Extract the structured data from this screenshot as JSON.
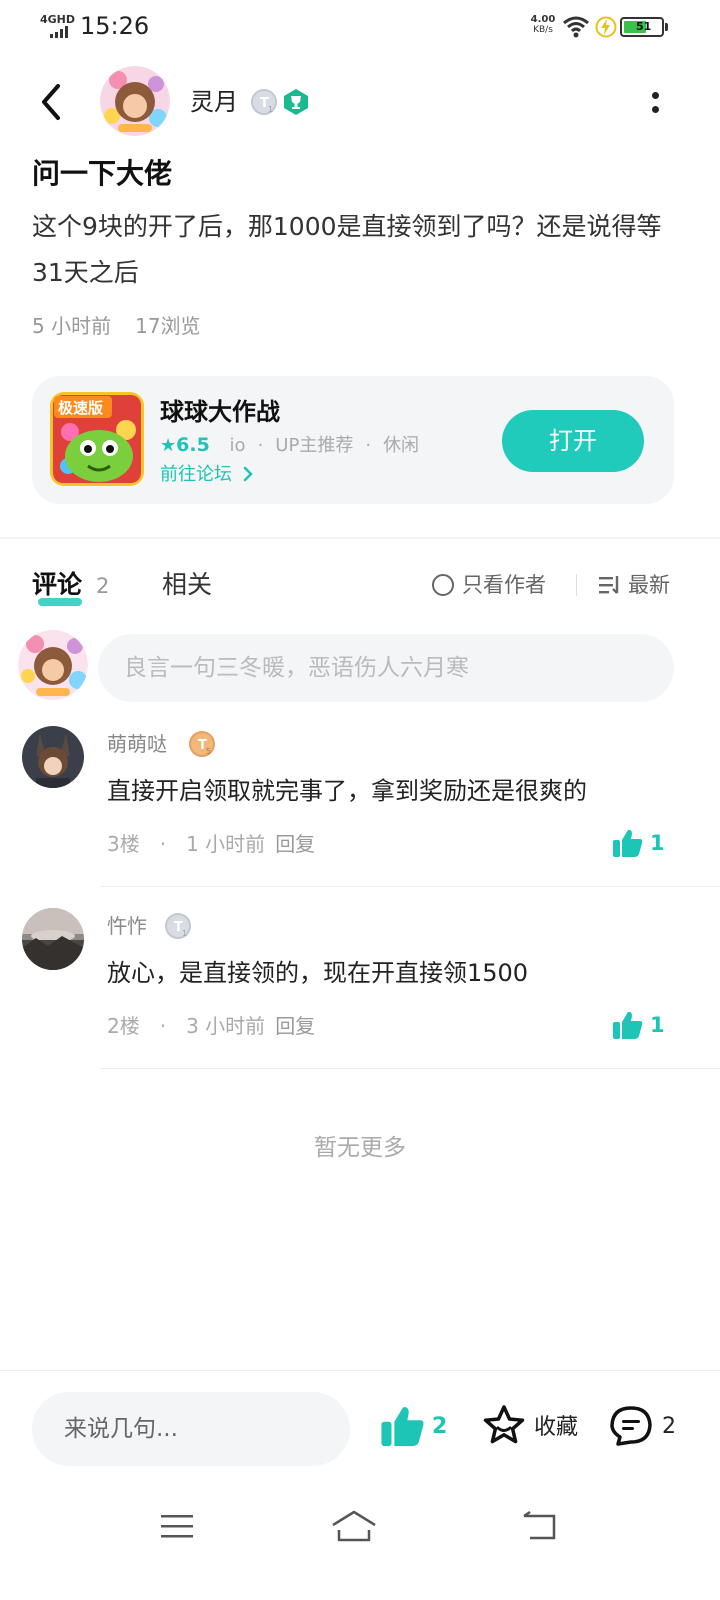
{
  "status_bar": {
    "network": "4GHD",
    "time": "15:26",
    "speed_value": "4.00",
    "speed_unit": "KB/s",
    "battery": "51"
  },
  "header": {
    "author_name": "灵月",
    "level_badge": "T1"
  },
  "post": {
    "title": "问一下大佬",
    "body": "这个9块的开了后，那1000是直接领到了吗？还是说得等31天之后",
    "time_ago": "5  小时前",
    "views": "17浏览"
  },
  "game_card": {
    "name": "球球大作战",
    "rating": "6.5",
    "tag1": "io",
    "tag2": "UP主推荐",
    "tag3": "休闲",
    "forum_link": "前往论坛",
    "open_label": "打开",
    "icon_banner": "极速版",
    "accent_color": "#20cbbc"
  },
  "tabs": {
    "comments_label": "评论",
    "comments_count": "2",
    "related_label": "相关",
    "author_only_label": "只看作者",
    "sort_label": "最新"
  },
  "comment_input": {
    "placeholder": "良言一句三冬暖，恶语伤人六月寒"
  },
  "comments": [
    {
      "name": "萌萌哒",
      "badge": "T5",
      "text": "直接开启领取就完事了，拿到奖励还是很爽的",
      "floor": "3楼",
      "time_ago": "1  小时前",
      "reply": "回复",
      "likes": "1"
    },
    {
      "name": "忤怍",
      "badge": "T1",
      "text": "放心，是直接领的，现在开直接领1500",
      "floor": "2楼",
      "time_ago": "3  小时前",
      "reply": "回复",
      "likes": "1"
    }
  ],
  "no_more": "暂无更多",
  "bottom_bar": {
    "input_placeholder": "来说几句...",
    "likes": "2",
    "favorite_label": "收藏",
    "comments": "2"
  }
}
